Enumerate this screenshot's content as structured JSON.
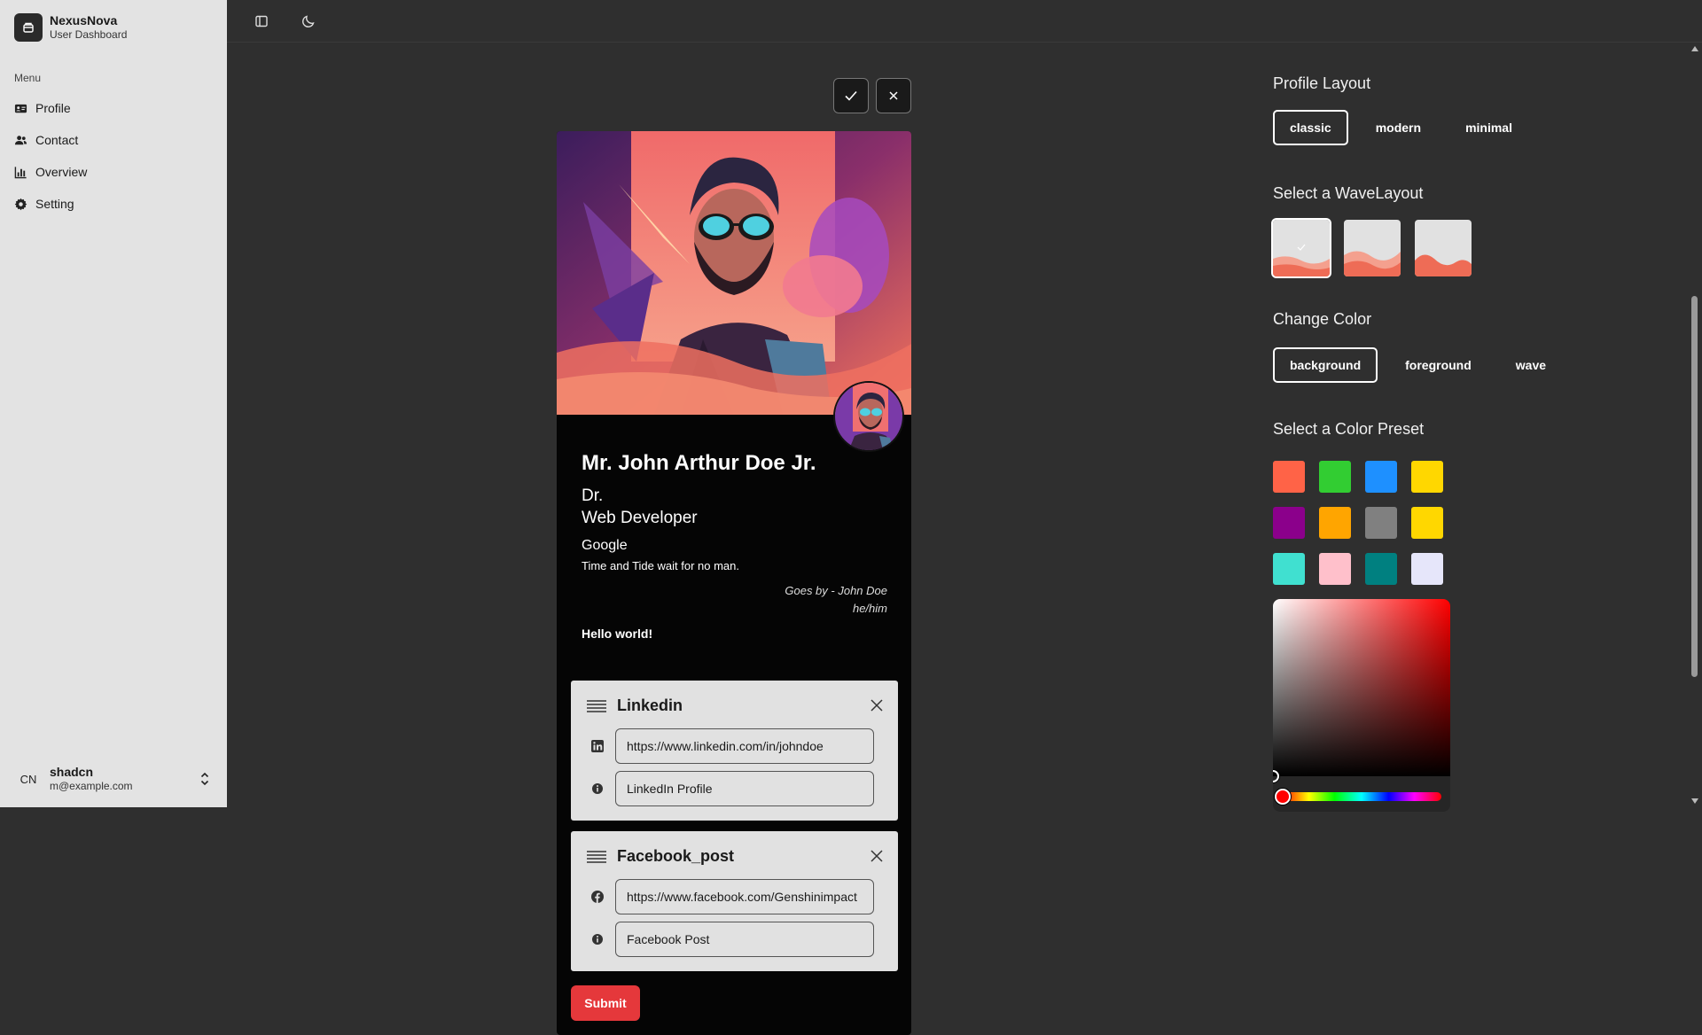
{
  "app": {
    "name": "NexusNova",
    "subtitle": "User Dashboard"
  },
  "sidebar": {
    "menu_title": "Menu",
    "items": [
      {
        "label": "Profile",
        "icon": "id-card-icon"
      },
      {
        "label": "Contact",
        "icon": "users-icon"
      },
      {
        "label": "Overview",
        "icon": "bar-chart-icon"
      },
      {
        "label": "Setting",
        "icon": "gear-icon"
      }
    ],
    "user": {
      "initials": "CN",
      "name": "shadcn",
      "email": "m@example.com"
    }
  },
  "profile": {
    "name": "Mr. John Arthur Doe Jr.",
    "prefix": "Dr.",
    "job": "Web Developer",
    "company": "Google",
    "quote": "Time and Tide wait for no man.",
    "goes_by": "Goes by - John Doe",
    "pronouns": "he/him",
    "bio": "Hello world!"
  },
  "links": [
    {
      "title": "Linkedin",
      "icon": "linkedin-icon",
      "url": "https://www.linkedin.com/in/johndoe",
      "label": "LinkedIn Profile"
    },
    {
      "title": "Facebook_post",
      "icon": "facebook-icon",
      "url": "https://www.facebook.com/Genshinimpact",
      "label": "Facebook Post"
    }
  ],
  "submit_label": "Submit",
  "panel": {
    "layout_title": "Profile Layout",
    "layouts": [
      "classic",
      "modern",
      "minimal"
    ],
    "layout_selected": "classic",
    "wave_title": "Select a WaveLayout",
    "color_title": "Change Color",
    "color_targets": [
      "background",
      "foreground",
      "wave"
    ],
    "color_target_selected": "background",
    "preset_title": "Select a Color Preset",
    "presets": [
      "#ff6347",
      "#32cd32",
      "#1e90ff",
      "#ffd700",
      "#8b008b",
      "#ffa500",
      "#808080",
      "#ffd700",
      "#40e0d0",
      "#ffc0cb",
      "#008080",
      "#e6e6fa"
    ],
    "picker_hue": "#ff0000"
  }
}
